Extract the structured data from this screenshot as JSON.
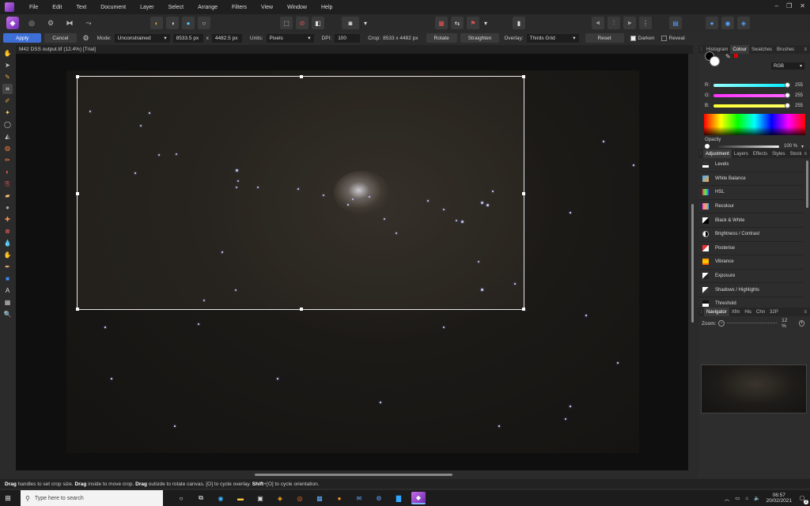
{
  "menubar": {
    "items": [
      "File",
      "Edit",
      "Text",
      "Document",
      "Layer",
      "Select",
      "Arrange",
      "Filters",
      "View",
      "Window",
      "Help"
    ]
  },
  "context": {
    "apply": "Apply",
    "cancel": "Cancel",
    "mode_label": "Mode:",
    "mode_value": "Unconstrained",
    "width_value": "8533.5 px",
    "x_label": "x",
    "height_value": "4482.5 px",
    "units_label": "Units:",
    "units_value": "Pixels",
    "dpi_label": "DPI:",
    "dpi_value": "100",
    "crop_label": "Crop:",
    "crop_value": "8533 x 4482 px",
    "rotate": "Rotate",
    "straighten": "Straighten",
    "overlay_label": "Overlay:",
    "overlay_value": "Thirds Grid",
    "reset": "Reset",
    "darken": "Darken",
    "reveal": "Reveal"
  },
  "document": {
    "title": "M42 DSS output.tif (12.4%) [Trial]"
  },
  "status": {
    "k1": "Drag",
    "t1": " handles to set crop size. ",
    "k2": "Drag",
    "t2": " inside to move crop. ",
    "k3": "Drag",
    "t3": " outside to rotate canvas. [O] to cycle overlay. ",
    "k4": "Shift",
    "t4": "+[O] to cycle orientation."
  },
  "colour_panel": {
    "tabs": [
      "Histogram",
      "Colour",
      "Swatches",
      "Brushes"
    ],
    "active_tab": "Colour",
    "mode": "RGB",
    "channels": [
      {
        "label": "R:",
        "value": "255",
        "color": "#00e5ff"
      },
      {
        "label": "G:",
        "value": "255",
        "color": "#ff33ff"
      },
      {
        "label": "B:",
        "value": "255",
        "color": "#ffff33"
      }
    ],
    "opacity_label": "Opacity",
    "opacity_value": "100 %"
  },
  "adjustment_panel": {
    "tabs": [
      "Adjustment",
      "Layers",
      "Effects",
      "Styles",
      "Stock"
    ],
    "active_tab": "Adjustment",
    "items": [
      "Levels",
      "White Balance",
      "HSL",
      "Recolour",
      "Black & White",
      "Brightness / Contrast",
      "Posterise",
      "Vibrance",
      "Exposure",
      "Shadows / Highlights",
      "Threshold"
    ]
  },
  "navigator_panel": {
    "tabs": [
      "Navigator",
      "Xfm",
      "His",
      "Chn",
      "32P"
    ],
    "active_tab": "Navigator",
    "zoom_label": "Zoom:",
    "zoom_value": "12 %"
  },
  "taskbar": {
    "search_placeholder": "Type here to search",
    "time": "06:57",
    "date": "20/02/2021",
    "notification_count": "2"
  }
}
